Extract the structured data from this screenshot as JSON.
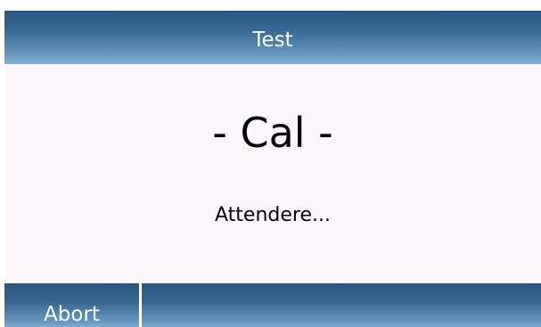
{
  "header": {
    "title": "Test"
  },
  "main": {
    "mode_label": "- Cal -",
    "status": "Attendere..."
  },
  "footer": {
    "abort_label": "Abort"
  },
  "colors": {
    "bar_dark": "#27567e",
    "bar_light": "#86b2d4",
    "content_bg": "#fcf7fb",
    "text": "#000000",
    "bar_text": "#ffffff"
  }
}
